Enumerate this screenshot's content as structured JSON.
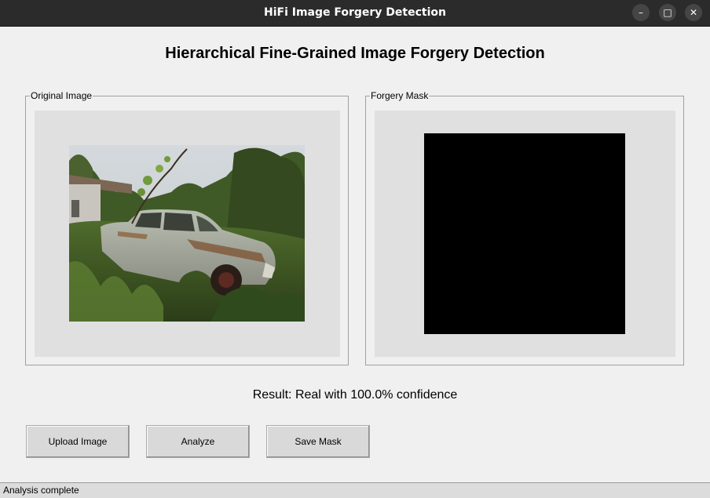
{
  "window": {
    "title": "HiFi Image Forgery Detection",
    "minimize_glyph": "–",
    "maximize_glyph": "□",
    "close_glyph": "✕"
  },
  "heading": "Hierarchical Fine-Grained Image Forgery Detection",
  "original_frame": {
    "label": "Original Image"
  },
  "mask_frame": {
    "label": "Forgery Mask"
  },
  "result_text": "Result: Real with 100.0% confidence",
  "buttons": {
    "upload": "Upload Image",
    "analyze": "Analyze",
    "save": "Save Mask"
  },
  "status": "Analysis complete",
  "colors": {
    "titlebar": "#2b2b2b",
    "background": "#f0f0f0",
    "canvas": "#e0e0e0",
    "mask": "#000000",
    "button": "#d9d9d9"
  }
}
